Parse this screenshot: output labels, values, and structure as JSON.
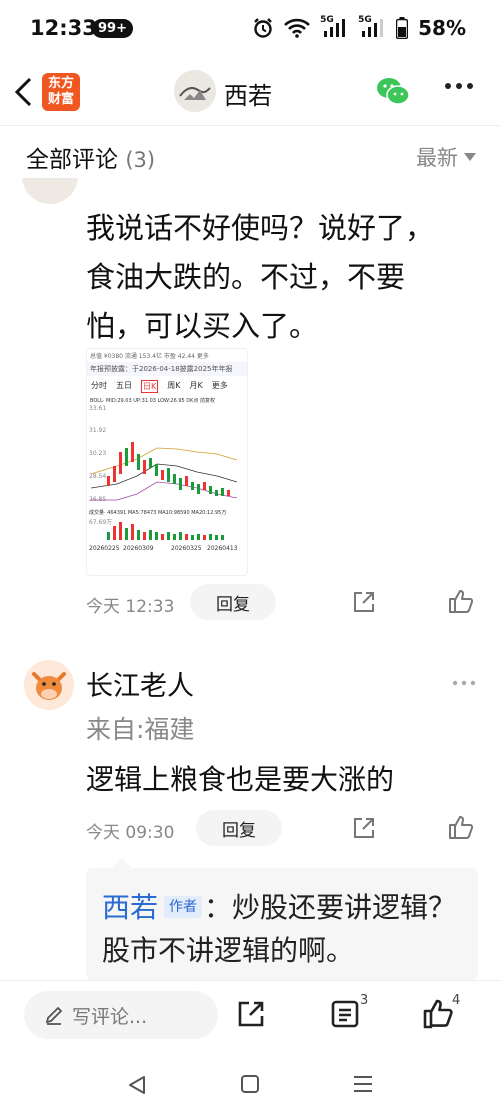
{
  "status_bar": {
    "time": "12:33",
    "badge": "99+",
    "battery": "58%",
    "net1": "5G",
    "net2": "5G"
  },
  "header": {
    "logo_line1": "东方",
    "logo_line2": "财富",
    "name": "西若"
  },
  "comments_header": {
    "title": "全部评论",
    "count": "(3)",
    "sort": "最新"
  },
  "comment1": {
    "text": "我说话不好使吗？说好了，食油大跌的。不过，不要怕，可以买入了。",
    "time": "今天 12:33",
    "reply": "回复",
    "thumb": {
      "top": "总值 ¥0380  流通 153.4亿  市盈 42.44  更多",
      "notice": "年报预披露：于2026-04-18披露2025年年报",
      "tabs": [
        "分时",
        "五日",
        "日K",
        "周K",
        "月K",
        "更多"
      ],
      "active_tab": "日K",
      "boll": "BOLL· MID:29.03 UP:31.03 LOW:26.95   DK点    前复权",
      "y_labels": [
        "33.61",
        "31.92",
        "30.23",
        "28.54",
        "26.85"
      ],
      "vol_label": "成交量· 464391  MA5:78473  MA10:98590  MA20:12.95万",
      "vol_max": "67.69万",
      "dates": [
        "20260225",
        "20260309",
        "20260325",
        "20260413"
      ]
    }
  },
  "comment2": {
    "name": "长江老人",
    "from": "来自:福建",
    "text": "逻辑上粮食也是要大涨的",
    "time": "今天 09:30",
    "reply": "回复",
    "sub_reply": {
      "name": "西若",
      "tag": "作者",
      "text": "：炒股还要讲逻辑？股市不讲逻辑的啊。"
    }
  },
  "bottom_bar": {
    "placeholder": "写评论...",
    "comment_count": "3",
    "like_count": "4"
  }
}
